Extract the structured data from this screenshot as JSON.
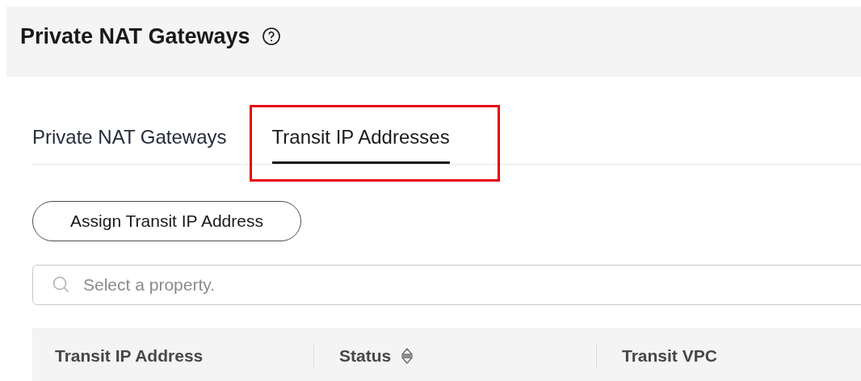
{
  "page": {
    "title": "Private NAT Gateways"
  },
  "tabs": [
    {
      "label": "Private NAT Gateways",
      "selected": false,
      "highlighted": false
    },
    {
      "label": "Transit IP Addresses",
      "selected": true,
      "highlighted": true
    }
  ],
  "toolbar": {
    "buttons": [
      "Assign Transit IP Address"
    ]
  },
  "search": {
    "placeholder": "Select a property."
  },
  "table": {
    "columns": [
      {
        "label": "Transit IP Address",
        "sortable": false
      },
      {
        "label": "Status",
        "sortable": true
      },
      {
        "label": "Transit VPC",
        "sortable": false
      }
    ]
  }
}
